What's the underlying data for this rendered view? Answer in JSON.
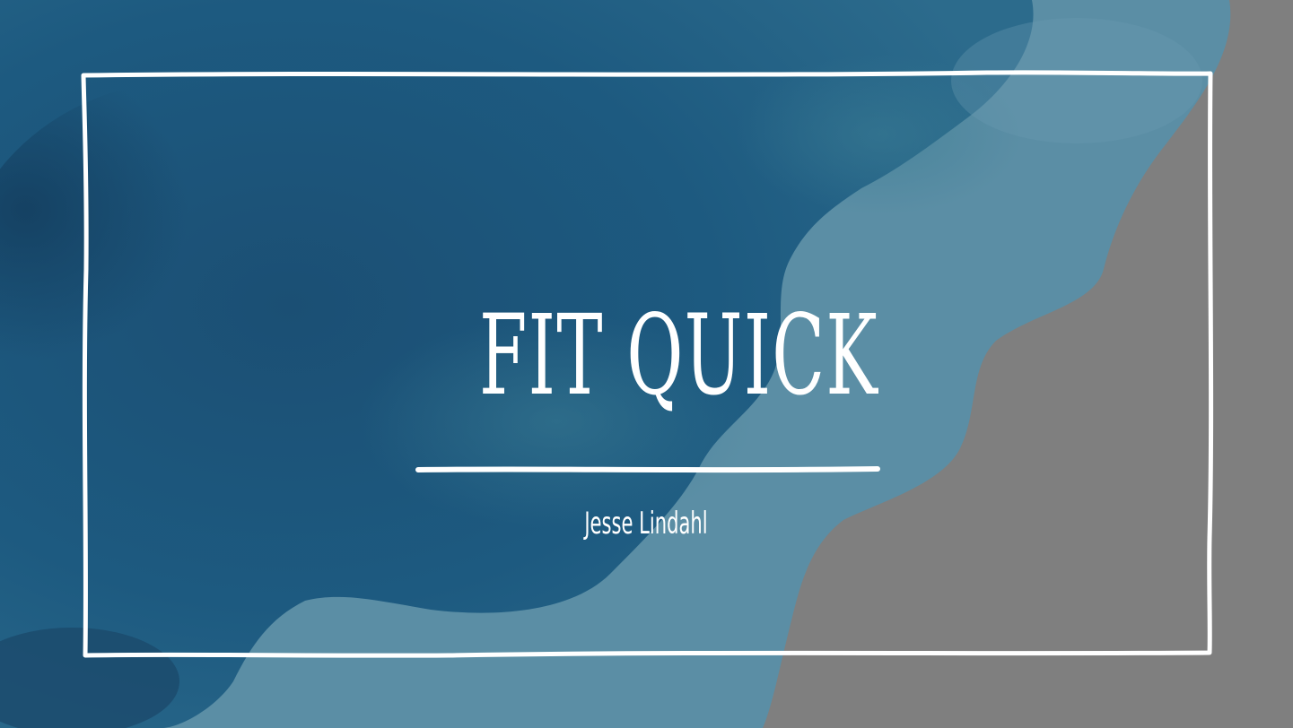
{
  "slide": {
    "title": "FIT QUICK",
    "subtitle": "Jesse Lindahl",
    "text_color": "#ffffff",
    "background_color": "#7f7f7f",
    "watercolor_color": "#1d5578",
    "frame_color": "#ffffff"
  }
}
